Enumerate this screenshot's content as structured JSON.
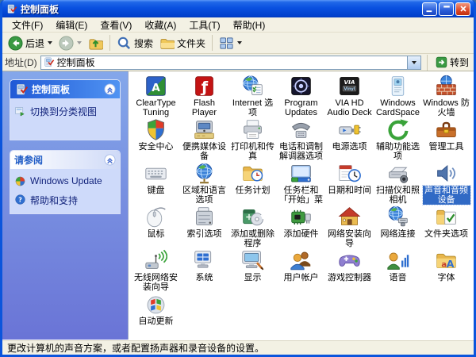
{
  "window": {
    "title": "控制面板"
  },
  "colors": {
    "selection": "#316ac5",
    "titlebar": "#0a50e0",
    "sidebar_top": "#84a7ea",
    "sidebar_bottom": "#6a74d6",
    "go_green": "#3a9a43"
  },
  "menu": {
    "items": [
      {
        "key": "file",
        "label": "文件(F)"
      },
      {
        "key": "edit",
        "label": "编辑(E)"
      },
      {
        "key": "view",
        "label": "查看(V)"
      },
      {
        "key": "favorites",
        "label": "收藏(A)"
      },
      {
        "key": "tools",
        "label": "工具(T)"
      },
      {
        "key": "help",
        "label": "帮助(H)"
      }
    ]
  },
  "toolbar": {
    "back_label": "后退",
    "search_label": "搜索",
    "folders_label": "文件夹"
  },
  "address": {
    "label": "地址(D)",
    "value": "控制面板",
    "go_label": "转到"
  },
  "sidebar": {
    "panels": [
      {
        "key": "control-panel",
        "title": "控制面板",
        "style": "blue",
        "icon": "control-panel-icon",
        "items": [
          {
            "key": "switch-view",
            "label": "切换到分类视图",
            "icon": "switch-view-icon"
          }
        ]
      },
      {
        "key": "see-also",
        "title": "请参阅",
        "style": "white",
        "items": [
          {
            "key": "windows-update",
            "label": "Windows Update",
            "icon": "windows-update-icon"
          },
          {
            "key": "help-support",
            "label": "帮助和支持",
            "icon": "help-icon"
          }
        ]
      }
    ]
  },
  "grid": {
    "items": [
      {
        "key": "cleartype-tuning",
        "label": "ClearType Tuning",
        "icon": "cleartype-tuning-icon"
      },
      {
        "key": "flash-player",
        "label": "Flash Player",
        "icon": "flash-player-icon"
      },
      {
        "key": "internet-options",
        "label": "Internet 选项",
        "icon": "internet-options-icon"
      },
      {
        "key": "program-updates",
        "label": "Program Updates",
        "icon": "program-updates-icon"
      },
      {
        "key": "via-hd-audio-deck",
        "label": "VIA HD Audio Deck",
        "icon": "via-hd-audio-icon"
      },
      {
        "key": "windows-cardspace",
        "label": "Windows CardSpace",
        "icon": "windows-cardspace-icon"
      },
      {
        "key": "windows-firewall",
        "label": "Windows 防火墙",
        "icon": "windows-firewall-icon"
      },
      {
        "key": "security-center",
        "label": "安全中心",
        "icon": "security-center-icon"
      },
      {
        "key": "portable-media-devices",
        "label": "便携媒体设备",
        "icon": "portable-media-icon"
      },
      {
        "key": "printers-faxes",
        "label": "打印机和传真",
        "icon": "printers-faxes-icon"
      },
      {
        "key": "phone-modem-options",
        "label": "电话和调制解调器选项",
        "icon": "phone-modem-icon"
      },
      {
        "key": "power-options",
        "label": "电源选项",
        "icon": "power-options-icon"
      },
      {
        "key": "accessibility-options",
        "label": "辅助功能选项",
        "icon": "accessibility-icon"
      },
      {
        "key": "administrative-tools",
        "label": "管理工具",
        "icon": "admin-tools-icon"
      },
      {
        "key": "keyboard",
        "label": "键盘",
        "icon": "keyboard-icon"
      },
      {
        "key": "regional-language-options",
        "label": "区域和语言选项",
        "icon": "regional-language-icon"
      },
      {
        "key": "scheduled-tasks",
        "label": "任务计划",
        "icon": "scheduled-tasks-icon"
      },
      {
        "key": "taskbar-start-menu",
        "label": "任务栏和「开始」菜单",
        "icon": "taskbar-startmenu-icon"
      },
      {
        "key": "date-time",
        "label": "日期和时间",
        "icon": "date-time-icon"
      },
      {
        "key": "scanners-cameras",
        "label": "扫描仪和照相机",
        "icon": "scanners-cameras-icon"
      },
      {
        "key": "sounds-audio-devices",
        "label": "声音和音频设备",
        "icon": "sounds-audio-icon",
        "selected": true
      },
      {
        "key": "mouse",
        "label": "鼠标",
        "icon": "mouse-icon"
      },
      {
        "key": "indexing-options",
        "label": "索引选项",
        "icon": "indexing-options-icon"
      },
      {
        "key": "add-remove-programs",
        "label": "添加或删除程序",
        "icon": "add-remove-programs-icon"
      },
      {
        "key": "add-hardware",
        "label": "添加硬件",
        "icon": "add-hardware-icon"
      },
      {
        "key": "network-setup-wizard",
        "label": "网络安装向导",
        "icon": "network-wizard-icon"
      },
      {
        "key": "network-connections",
        "label": "网络连接",
        "icon": "network-connections-icon"
      },
      {
        "key": "folder-options",
        "label": "文件夹选项",
        "icon": "folder-options-icon"
      },
      {
        "key": "wireless-network-setup-wizard",
        "label": "无线网络安装向导",
        "icon": "wireless-wizard-icon"
      },
      {
        "key": "system",
        "label": "系统",
        "icon": "system-icon"
      },
      {
        "key": "display",
        "label": "显示",
        "icon": "display-icon"
      },
      {
        "key": "user-accounts",
        "label": "用户帐户",
        "icon": "user-accounts-icon"
      },
      {
        "key": "game-controllers",
        "label": "游戏控制器",
        "icon": "game-controllers-icon"
      },
      {
        "key": "speech",
        "label": "语音",
        "icon": "speech-icon"
      },
      {
        "key": "fonts",
        "label": "字体",
        "icon": "fonts-icon"
      },
      {
        "key": "automatic-updates",
        "label": "自动更新",
        "icon": "automatic-updates-icon"
      }
    ]
  },
  "statusbar": {
    "text": "更改计算机的声音方案，或者配置扬声器和录音设备的设置。"
  }
}
